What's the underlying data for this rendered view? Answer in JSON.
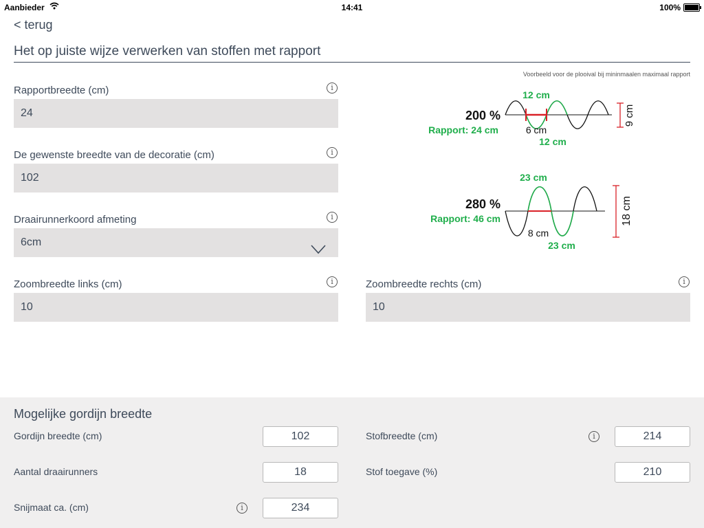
{
  "status_bar": {
    "carrier": "Aanbieder",
    "time": "14:41",
    "battery": "100%"
  },
  "nav": {
    "back_label": "< terug"
  },
  "page": {
    "title": "Het op juiste wijze verwerken van stoffen met rapport"
  },
  "form": {
    "rapportbreedte": {
      "label": "Rapportbreedte (cm)",
      "value": "24"
    },
    "decoratie_breedte": {
      "label": "De gewenste breedte van de decoratie (cm)",
      "value": "102"
    },
    "draairunnerkoord": {
      "label": "Draairunnerkoord afmeting",
      "value": "6cm"
    },
    "zoom_links": {
      "label": "Zoombreedte links (cm)",
      "value": "10"
    },
    "zoom_rechts": {
      "label": "Zoombreedte rechts (cm)",
      "value": "10"
    }
  },
  "example": {
    "caption": "Voorbeeld voor de plooival bij mininmaalen maximaal rapport",
    "diagram1": {
      "percent": "200 %",
      "rapport": "Rapport: 24 cm",
      "top_width": "12 cm",
      "runner": "6 cm",
      "bottom_width": "12 cm",
      "height": "9 cm"
    },
    "diagram2": {
      "percent": "280 %",
      "rapport": "Rapport: 46 cm",
      "top_width": "23 cm",
      "runner": "8 cm",
      "bottom_width": "23 cm",
      "height": "18 cm"
    },
    "colors": {
      "green": "#1fae4b",
      "red": "#d92027",
      "black": "#111111"
    }
  },
  "results": {
    "title": "Mogelijke gordijn breedte",
    "gordijn_breedte": {
      "label": "Gordijn breedte (cm)",
      "value": "102"
    },
    "aantal_draairunners": {
      "label": "Aantal draairunners",
      "value": "18"
    },
    "snijmaat": {
      "label": "Snijmaat ca. (cm)",
      "value": "234"
    },
    "stofbreedte": {
      "label": "Stofbreedte (cm)",
      "value": "214"
    },
    "stof_toegave": {
      "label": "Stof toegave (%)",
      "value": "210"
    }
  },
  "icons": {
    "info": "info-icon",
    "chevron": "chevron-down-icon",
    "wifi": "wifi-icon",
    "battery": "battery-icon"
  }
}
